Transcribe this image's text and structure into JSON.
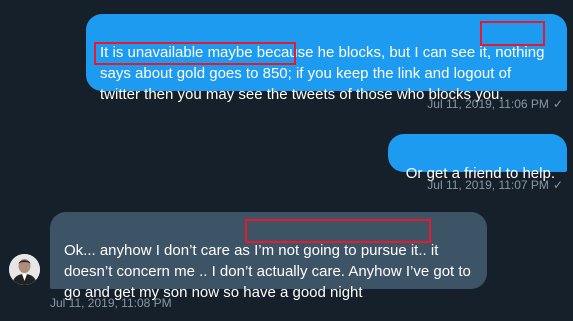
{
  "messages": [
    {
      "direction": "sent",
      "text": "It is unavailable maybe because he blocks, but I can see it, nothing says about gold goes to 850; if you keep the link and logout of twitter then you may see the tweets of those who blocks you.",
      "timestamp": "Jul 11, 2019, 11:06 PM",
      "status_icon": "checkmark-icon"
    },
    {
      "direction": "sent",
      "text": "Or get a friend to help.",
      "timestamp": "Jul 11, 2019, 11:07 PM",
      "status_icon": "checkmark-icon"
    },
    {
      "direction": "received",
      "text": "Ok... anyhow I don’t care as I’m not going to pursue it.. it doesn’t concern me .. I don’t actually care. Anyhow I’ve got to go and get my son now so have a good night",
      "timestamp": "Jul 11, 2019, 11:08 PM",
      "avatar_icon": "user-avatar-icon"
    }
  ],
  "highlights": [
    {
      "text": "nothing"
    },
    {
      "text": "says about gold goes to 850;"
    },
    {
      "text": "I’m not going to pursue it.."
    }
  ],
  "colors": {
    "background": "#15202b",
    "sent_bubble": "#1d9bf0",
    "received_bubble": "#3d5466",
    "meta_text": "#8899a6",
    "highlight_box": "#e8192c"
  }
}
